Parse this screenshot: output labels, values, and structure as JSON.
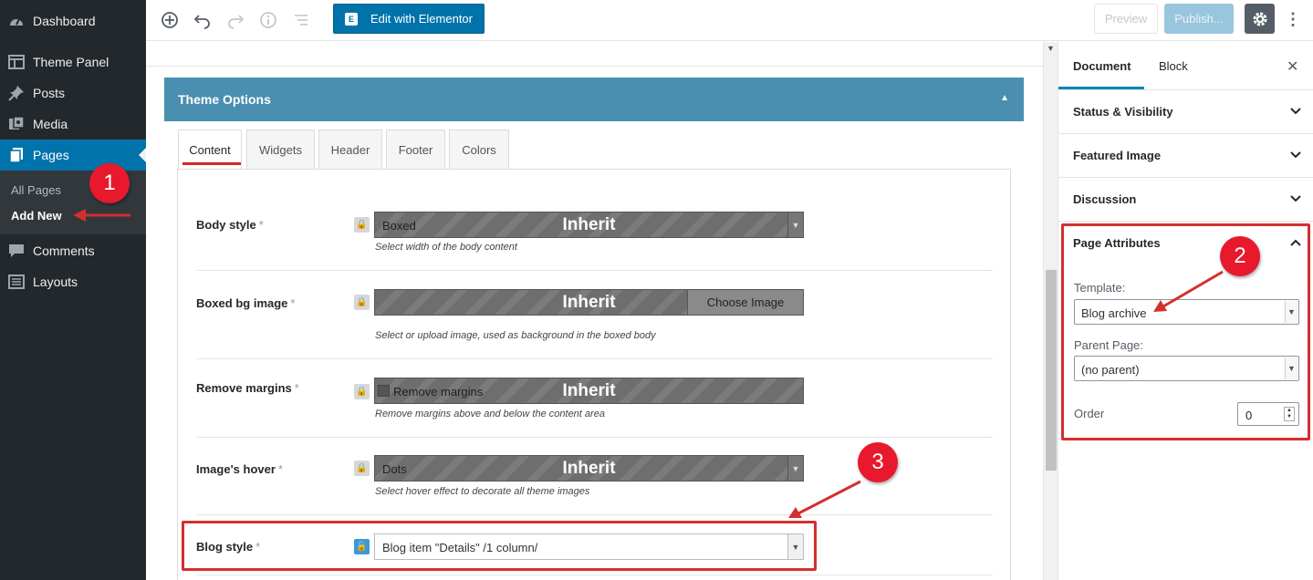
{
  "sidebar": {
    "items": [
      {
        "label": "Dashboard",
        "icon": "dashboard-icon"
      },
      {
        "label": "Theme Panel",
        "icon": "theme-panel-icon"
      },
      {
        "label": "Posts",
        "icon": "pin-icon"
      },
      {
        "label": "Media",
        "icon": "media-icon"
      },
      {
        "label": "Pages",
        "icon": "pages-icon"
      },
      {
        "label": "Comments",
        "icon": "comment-icon"
      },
      {
        "label": "Layouts",
        "icon": "layouts-icon"
      }
    ],
    "submenu": {
      "all_pages": "All Pages",
      "add_new": "Add New"
    }
  },
  "toolbar": {
    "elementor_label": "Edit with Elementor",
    "preview_label": "Preview",
    "publish_label": "Publish..."
  },
  "theme_options": {
    "title": "Theme Options",
    "tabs": [
      "Content",
      "Widgets",
      "Header",
      "Footer",
      "Colors"
    ],
    "rows": [
      {
        "label": "Body style",
        "value": "Boxed",
        "inherit": "Inherit",
        "hint": "Select width of the body content"
      },
      {
        "label": "Boxed bg image",
        "button": "Choose Image",
        "inherit": "Inherit",
        "hint": "Select or upload image, used as background in the boxed body"
      },
      {
        "label": "Remove margins",
        "value": "Remove margins",
        "inherit": "Inherit",
        "hint": "Remove margins above and below the content area"
      },
      {
        "label": "Image's hover",
        "value": "Dots",
        "inherit": "Inherit",
        "hint": "Select hover effect to decorate all theme images"
      },
      {
        "label": "Blog style",
        "value": "Blog item \"Details\" /1 column/"
      }
    ],
    "required_mark": "*"
  },
  "settings_panel": {
    "tabs": [
      "Document",
      "Block"
    ],
    "sections": [
      "Status & Visibility",
      "Featured Image",
      "Discussion",
      "Page Attributes"
    ],
    "template_label": "Template:",
    "template_value": "Blog archive",
    "parent_label": "Parent Page:",
    "parent_value": "(no parent)",
    "order_label": "Order",
    "order_value": "0"
  },
  "annotations": {
    "one": "1",
    "two": "2",
    "three": "3"
  },
  "colors": {
    "accent": "#0073aa",
    "annotation": "#e8192c",
    "theme_header": "#4a8fb0"
  }
}
